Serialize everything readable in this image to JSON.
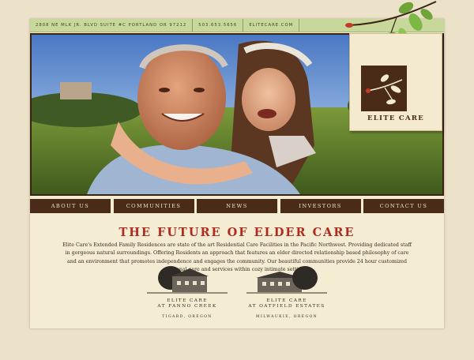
{
  "topbar": {
    "address": "2808 NE MLK Jr. Blvd Suite #C   Portland or 97212",
    "phone": "503.653.5656",
    "website": "elitecare.com"
  },
  "logo": {
    "text": "ELITE CARE"
  },
  "nav": [
    {
      "label": "About Us"
    },
    {
      "label": "Communities"
    },
    {
      "label": "News"
    },
    {
      "label": "Investors"
    },
    {
      "label": "Contact Us"
    }
  ],
  "main": {
    "headline": "THE FUTURE OF ELDER CARE",
    "body": "Elite Care's Extended Family Residences are state of the art Residential Care Facilities in the Pacific Northwest. Providing dedicated staff in gorgeous natural surroundings. Offering Residents an approach that features an elder directed relationship based philosophy of care and an environment that promotes independence and engages the community. Our beautiful communities provide 24 hour customized personal care and services within cozy intimate settings."
  },
  "communities": [
    {
      "line1": "Elite Care",
      "line2": "at Fanno Creek",
      "location": "Tigard, Oregon"
    },
    {
      "line1": "Elite Care",
      "line2": "at Oatfield Estates",
      "location": "Milwaukie, Oregon"
    }
  ],
  "colors": {
    "brand_brown": "#4a2b17",
    "headline_red": "#b12a1f",
    "topbar_green": "#c7d89a",
    "paper": "#f5ecd4"
  }
}
